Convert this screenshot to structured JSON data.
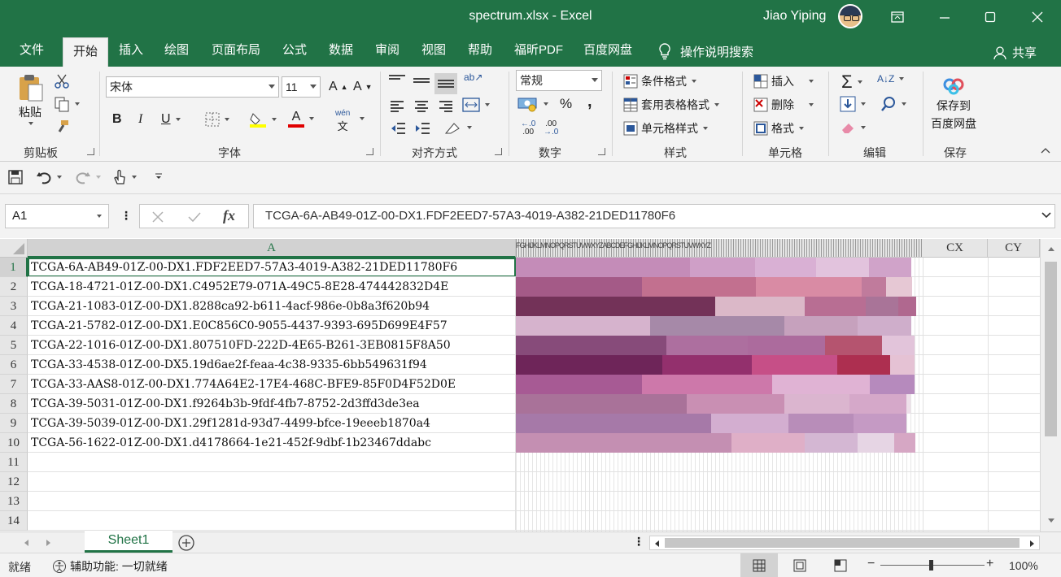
{
  "window": {
    "title": "spectrum.xlsx  -  Excel",
    "user": "Jiao Yiping",
    "controls": {
      "ribbon_display": "ribbon-display-icon",
      "minimize": "minimize-icon",
      "maximize": "maximize-icon",
      "close": "close-icon"
    }
  },
  "tabs": [
    "文件",
    "开始",
    "插入",
    "绘图",
    "页面布局",
    "公式",
    "数据",
    "审阅",
    "视图",
    "帮助",
    "福昕PDF",
    "百度网盘"
  ],
  "active_tab": "开始",
  "tell_me": "操作说明搜索",
  "share": "共享",
  "ribbon": {
    "clipboard": {
      "paste": "粘贴",
      "label": "剪贴板"
    },
    "font": {
      "name": "宋体",
      "size": "11",
      "label": "字体",
      "bold": "B",
      "italic": "I",
      "underline": "U",
      "grow": "A",
      "shrink": "A",
      "font_color": "A",
      "phonetic": "wén"
    },
    "alignment": {
      "label": "对齐方式"
    },
    "number": {
      "format": "常规",
      "label": "数字",
      "percent": "%",
      "comma": ","
    },
    "styles": {
      "conditional": "条件格式",
      "table": "套用表格格式",
      "cell_styles": "单元格样式",
      "label": "样式"
    },
    "cells": {
      "insert": "插入",
      "delete": "删除",
      "format": "格式",
      "label": "单元格"
    },
    "editing": {
      "label": "编辑"
    },
    "save": {
      "line1": "保存到",
      "line2": "百度网盘",
      "label": "保存"
    }
  },
  "formula_bar": {
    "name_box": "A1",
    "fx": "fx",
    "formula": "TCGA-6A-AB49-01Z-00-DX1.FDF2EED7-57A3-4019-A382-21DED11780F6"
  },
  "columns": {
    "a": "A",
    "narrow_header_text": "FGHIJKLMNOPQRSTUVWXYZABCDEFGHIJKLMNOPQRSTUVWXYZ",
    "cx": "CX",
    "cy": "CY"
  },
  "rows": [
    {
      "n": "1",
      "a": "TCGA-6A-AB49-01Z-00-DX1.FDF2EED7-57A3-4019-A382-21DED11780F6"
    },
    {
      "n": "2",
      "a": "TCGA-18-4721-01Z-00-DX1.C4952E79-071A-49C5-8E28-474442832D4E"
    },
    {
      "n": "3",
      "a": "TCGA-21-1083-01Z-00-DX1.8288ca92-b611-4acf-986e-0b8a3f620b94"
    },
    {
      "n": "4",
      "a": "TCGA-21-5782-01Z-00-DX1.E0C856C0-9055-4437-9393-695D699E4F57"
    },
    {
      "n": "5",
      "a": "TCGA-22-1016-01Z-00-DX1.807510FD-222D-4E65-B261-3EB0815F8A50"
    },
    {
      "n": "6",
      "a": "TCGA-33-4538-01Z-00-DX5.19d6ae2f-feaa-4c38-9335-6bb549631f94"
    },
    {
      "n": "7",
      "a": "TCGA-33-AAS8-01Z-00-DX1.774A64E2-17E4-468C-BFE9-85F0D4F52D0E"
    },
    {
      "n": "8",
      "a": "TCGA-39-5031-01Z-00-DX1.f9264b3b-9fdf-4fb7-8752-2d3ffd3de3ea"
    },
    {
      "n": "9",
      "a": "TCGA-39-5039-01Z-00-DX1.29f1281d-93d7-4499-bfce-19eeeb1870a4"
    },
    {
      "n": "10",
      "a": "TCGA-56-1622-01Z-00-DX1.d4178664-1e21-452f-9dbf-1b23467ddabc"
    },
    {
      "n": "11",
      "a": ""
    },
    {
      "n": "12",
      "a": ""
    },
    {
      "n": "13",
      "a": ""
    },
    {
      "n": "14",
      "a": ""
    }
  ],
  "color_strips": [
    [
      [
        "#c48cb8",
        214
      ],
      [
        "#cf9fc7",
        80
      ],
      [
        "#d9b0d4",
        75
      ],
      [
        "#e2c3dd",
        65
      ],
      [
        "#d0a3c9",
        52
      ]
    ],
    [
      [
        "#a45a87",
        155
      ],
      [
        "#c2708f",
        140
      ],
      [
        "#d98ba4",
        130
      ],
      [
        "#c07b9c",
        30
      ],
      [
        "#e6c8d4",
        32
      ]
    ],
    [
      [
        "#733258",
        245
      ],
      [
        "#dbb8c8",
        110
      ],
      [
        "#b86e93",
        75
      ],
      [
        "#a97498",
        40
      ],
      [
        "#b0688f",
        22
      ]
    ],
    [
      [
        "#d6b3cd",
        165
      ],
      [
        "#a689a8",
        165
      ],
      [
        "#c6a1bd",
        90
      ],
      [
        "#cfaecb",
        66
      ]
    ],
    [
      [
        "#874b7a",
        185
      ],
      [
        "#ad6f9f",
        100
      ],
      [
        "#ac6b9d",
        95
      ],
      [
        "#b5546f",
        70
      ],
      [
        "#e2c4da",
        40
      ]
    ],
    [
      [
        "#6e2559",
        180
      ],
      [
        "#93306d",
        110
      ],
      [
        "#c64f87",
        105
      ],
      [
        "#ad2f50",
        65
      ],
      [
        "#e5c2d4",
        30
      ]
    ],
    [
      [
        "#a75a94",
        155
      ],
      [
        "#cd78aa",
        160
      ],
      [
        "#e0b3d4",
        120
      ],
      [
        "#b68abd",
        55
      ]
    ],
    [
      [
        "#a97299",
        210
      ],
      [
        "#c98fb3",
        120
      ],
      [
        "#dbb5cf",
        80
      ],
      [
        "#d5a8c9",
        70
      ],
      [
        "#eee0ea",
        5
      ]
    ],
    [
      [
        "#a679a8",
        240
      ],
      [
        "#d3aed0",
        95
      ],
      [
        "#b88db9",
        80
      ],
      [
        "#c59ac4",
        65
      ]
    ],
    [
      [
        "#c48fb2",
        265
      ],
      [
        "#dfafc7",
        90
      ],
      [
        "#d4b7d3",
        65
      ],
      [
        "#e6d5e4",
        45
      ],
      [
        "#d6a7c4",
        26
      ]
    ]
  ],
  "sheets": [
    "Sheet1"
  ],
  "status": {
    "ready": "就绪",
    "accessibility": "辅助功能: 一切就绪",
    "zoom": "100%"
  }
}
